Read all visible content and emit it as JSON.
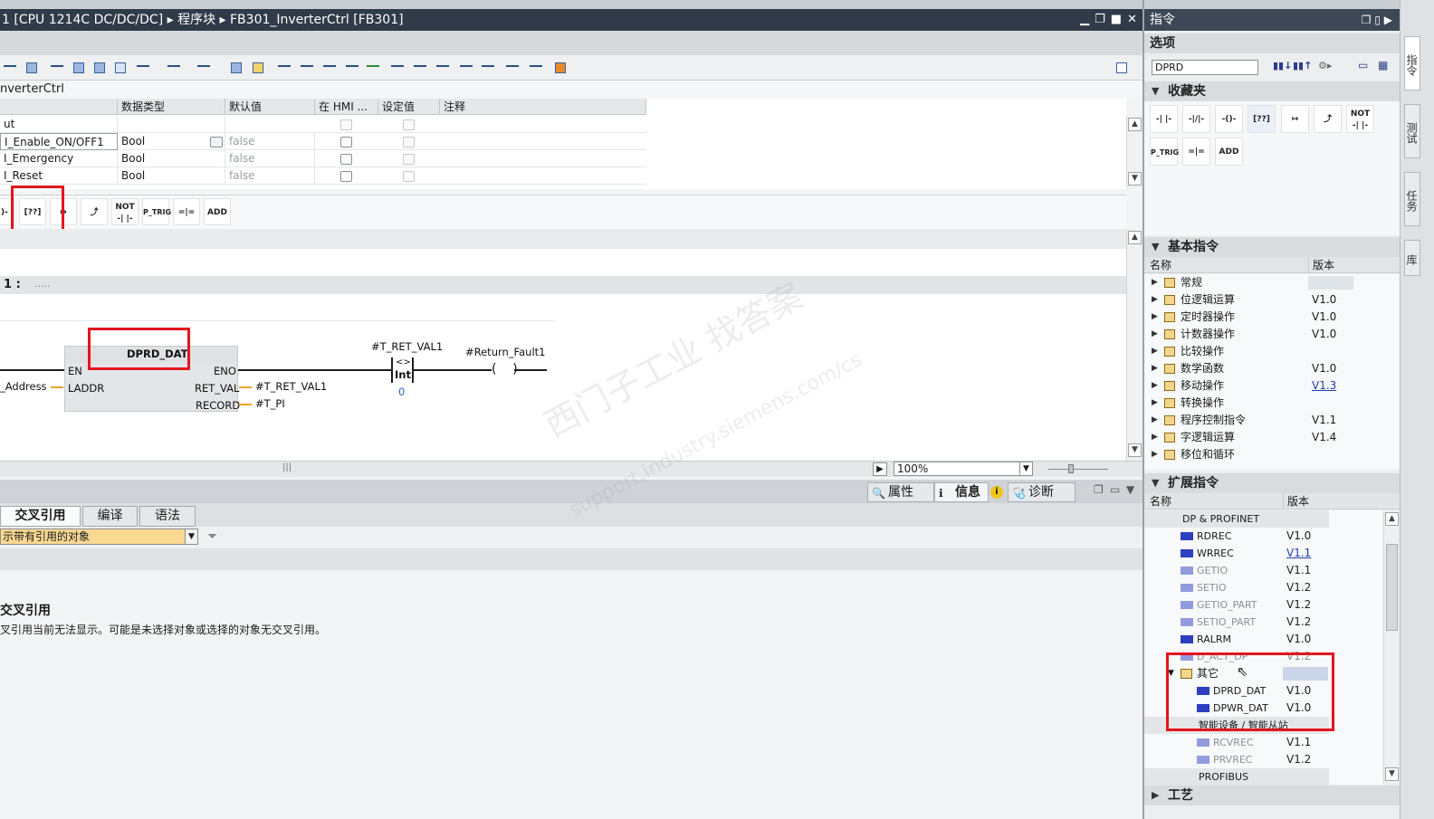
{
  "editor": {
    "title": "1 [CPU 1214C DC/DC/DC]  ▸  程序块  ▸  FB301_InverterCtrl [FB301]",
    "block_name": "nverterCtrl",
    "interface_headers": [
      "",
      "数据类型",
      "默认值",
      "在 HMI ...",
      "设定值",
      "注释"
    ],
    "interface_rows": [
      {
        "name": "ut",
        "type": "",
        "default": ""
      },
      {
        "name": "I_Enable_ON/OFF1",
        "type": "Bool",
        "default": "false"
      },
      {
        "name": "I_Emergency",
        "type": "Bool",
        "default": "false"
      },
      {
        "name": "I_Reset",
        "type": "Bool",
        "default": "false"
      }
    ],
    "favorites": [
      "NOT",
      "P_TRIG",
      "ADD"
    ],
    "network_label": "1 :",
    "network_dots": ".....",
    "block_title": "DPRD_DAT",
    "pins": {
      "en": "EN",
      "laddr": "LADDR",
      "eno": "ENO",
      "ret_val": "RET_VAL",
      "record": "RECORD"
    },
    "laddr_operand": "_Address",
    "ret_val_operand": "#T_RET_VAL1",
    "record_operand": "#T_PI",
    "compare_operand": "#T_RET_VAL1",
    "compare_op": "<>",
    "compare_type": "Int",
    "compare_value": "0",
    "coil_operand": "#Return_Fault1",
    "zoom": "100%"
  },
  "inspector": {
    "tabs": [
      "属性",
      "信息",
      "诊断"
    ],
    "info_badge": "i",
    "subtabs": [
      "交叉引用",
      "编译",
      "语法"
    ],
    "filter_value": "示带有引用的对象",
    "xref_title": "交叉引用",
    "xref_message": "叉引用当前无法显示。可能是未选择对象或选择的对象无交叉引用。"
  },
  "taskcard": {
    "title": "指令",
    "options_label": "选项",
    "search_value": "DPRD",
    "favorites_label": "收藏夹",
    "favorites_items": [
      "NOT",
      "P_TRIG",
      "ADD"
    ],
    "basic_label": "基本指令",
    "col_name": "名称",
    "col_version": "版本",
    "basic_rows": [
      {
        "name": "常规",
        "version": ""
      },
      {
        "name": "位逻辑运算",
        "version": "V1.0"
      },
      {
        "name": "定时器操作",
        "version": "V1.0"
      },
      {
        "name": "计数器操作",
        "version": "V1.0"
      },
      {
        "name": "比较操作",
        "version": ""
      },
      {
        "name": "数学函数",
        "version": "V1.0"
      },
      {
        "name": "移动操作",
        "version": "V1.3"
      },
      {
        "name": "转换操作",
        "version": ""
      },
      {
        "name": "程序控制指令",
        "version": "V1.1"
      },
      {
        "name": "字逻辑运算",
        "version": "V1.4"
      },
      {
        "name": "移位和循环",
        "version": ""
      }
    ],
    "extended_label": "扩展指令",
    "ext_rows": [
      {
        "name": "DP & PROFINET",
        "version": ""
      },
      {
        "name": "RDREC",
        "version": "V1.0"
      },
      {
        "name": "WRREC",
        "version": "V1.1"
      },
      {
        "name": "GETIO",
        "version": "V1.1"
      },
      {
        "name": "SETIO",
        "version": "V1.2"
      },
      {
        "name": "GETIO_PART",
        "version": "V1.2"
      },
      {
        "name": "SETIO_PART",
        "version": "V1.2"
      },
      {
        "name": "RALRM",
        "version": "V1.0"
      },
      {
        "name": "D_ACT_DP",
        "version": "V1.2"
      },
      {
        "name": "其它",
        "version": ""
      },
      {
        "name": "DPRD_DAT",
        "version": "V1.0"
      },
      {
        "name": "DPWR_DAT",
        "version": "V1.0"
      },
      {
        "name": "智能设备 / 智能从站",
        "version": ""
      },
      {
        "name": "RCVREC",
        "version": "V1.1"
      },
      {
        "name": "PRVREC",
        "version": "V1.2"
      },
      {
        "name": "PROFIBUS",
        "version": ""
      }
    ],
    "tech_label": "工艺"
  },
  "side_tabs": [
    "指令",
    "测试",
    "任务",
    "库"
  ],
  "watermark": {
    "line1": "西门子工业 找答案",
    "line2": "support.industry.siemens.com/cs"
  }
}
